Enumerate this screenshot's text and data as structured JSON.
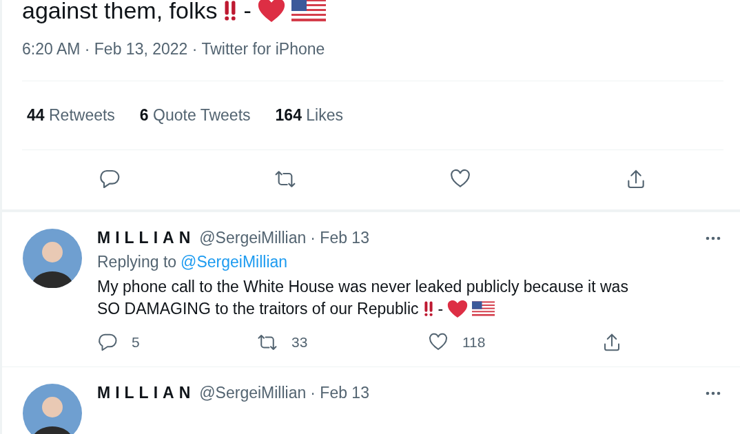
{
  "tweet": {
    "text": "against them, folks",
    "dash": "-",
    "timestamp": "6:20 AM · Feb 13, 2022 · Twitter for iPhone",
    "stats": [
      {
        "count": "44",
        "label": "Retweets"
      },
      {
        "count": "6",
        "label": "Quote Tweets"
      },
      {
        "count": "164",
        "label": "Likes"
      }
    ]
  },
  "replies": [
    {
      "display_name": "MILLIAN",
      "handle": "@SergeiMillian",
      "date": "· Feb 13",
      "replying_label": "Replying to",
      "replying_to": "@SergeiMillian",
      "text_lines": [
        "My phone call to the White House was never leaked publicly because it was",
        "SO DAMAGING to the traitors of our Republic"
      ],
      "dash": "-",
      "reply_count": "5",
      "retweet_count": "33",
      "like_count": "118"
    },
    {
      "display_name": "MILLIAN",
      "handle": "@SergeiMillian",
      "date": "· Feb 13"
    }
  ]
}
